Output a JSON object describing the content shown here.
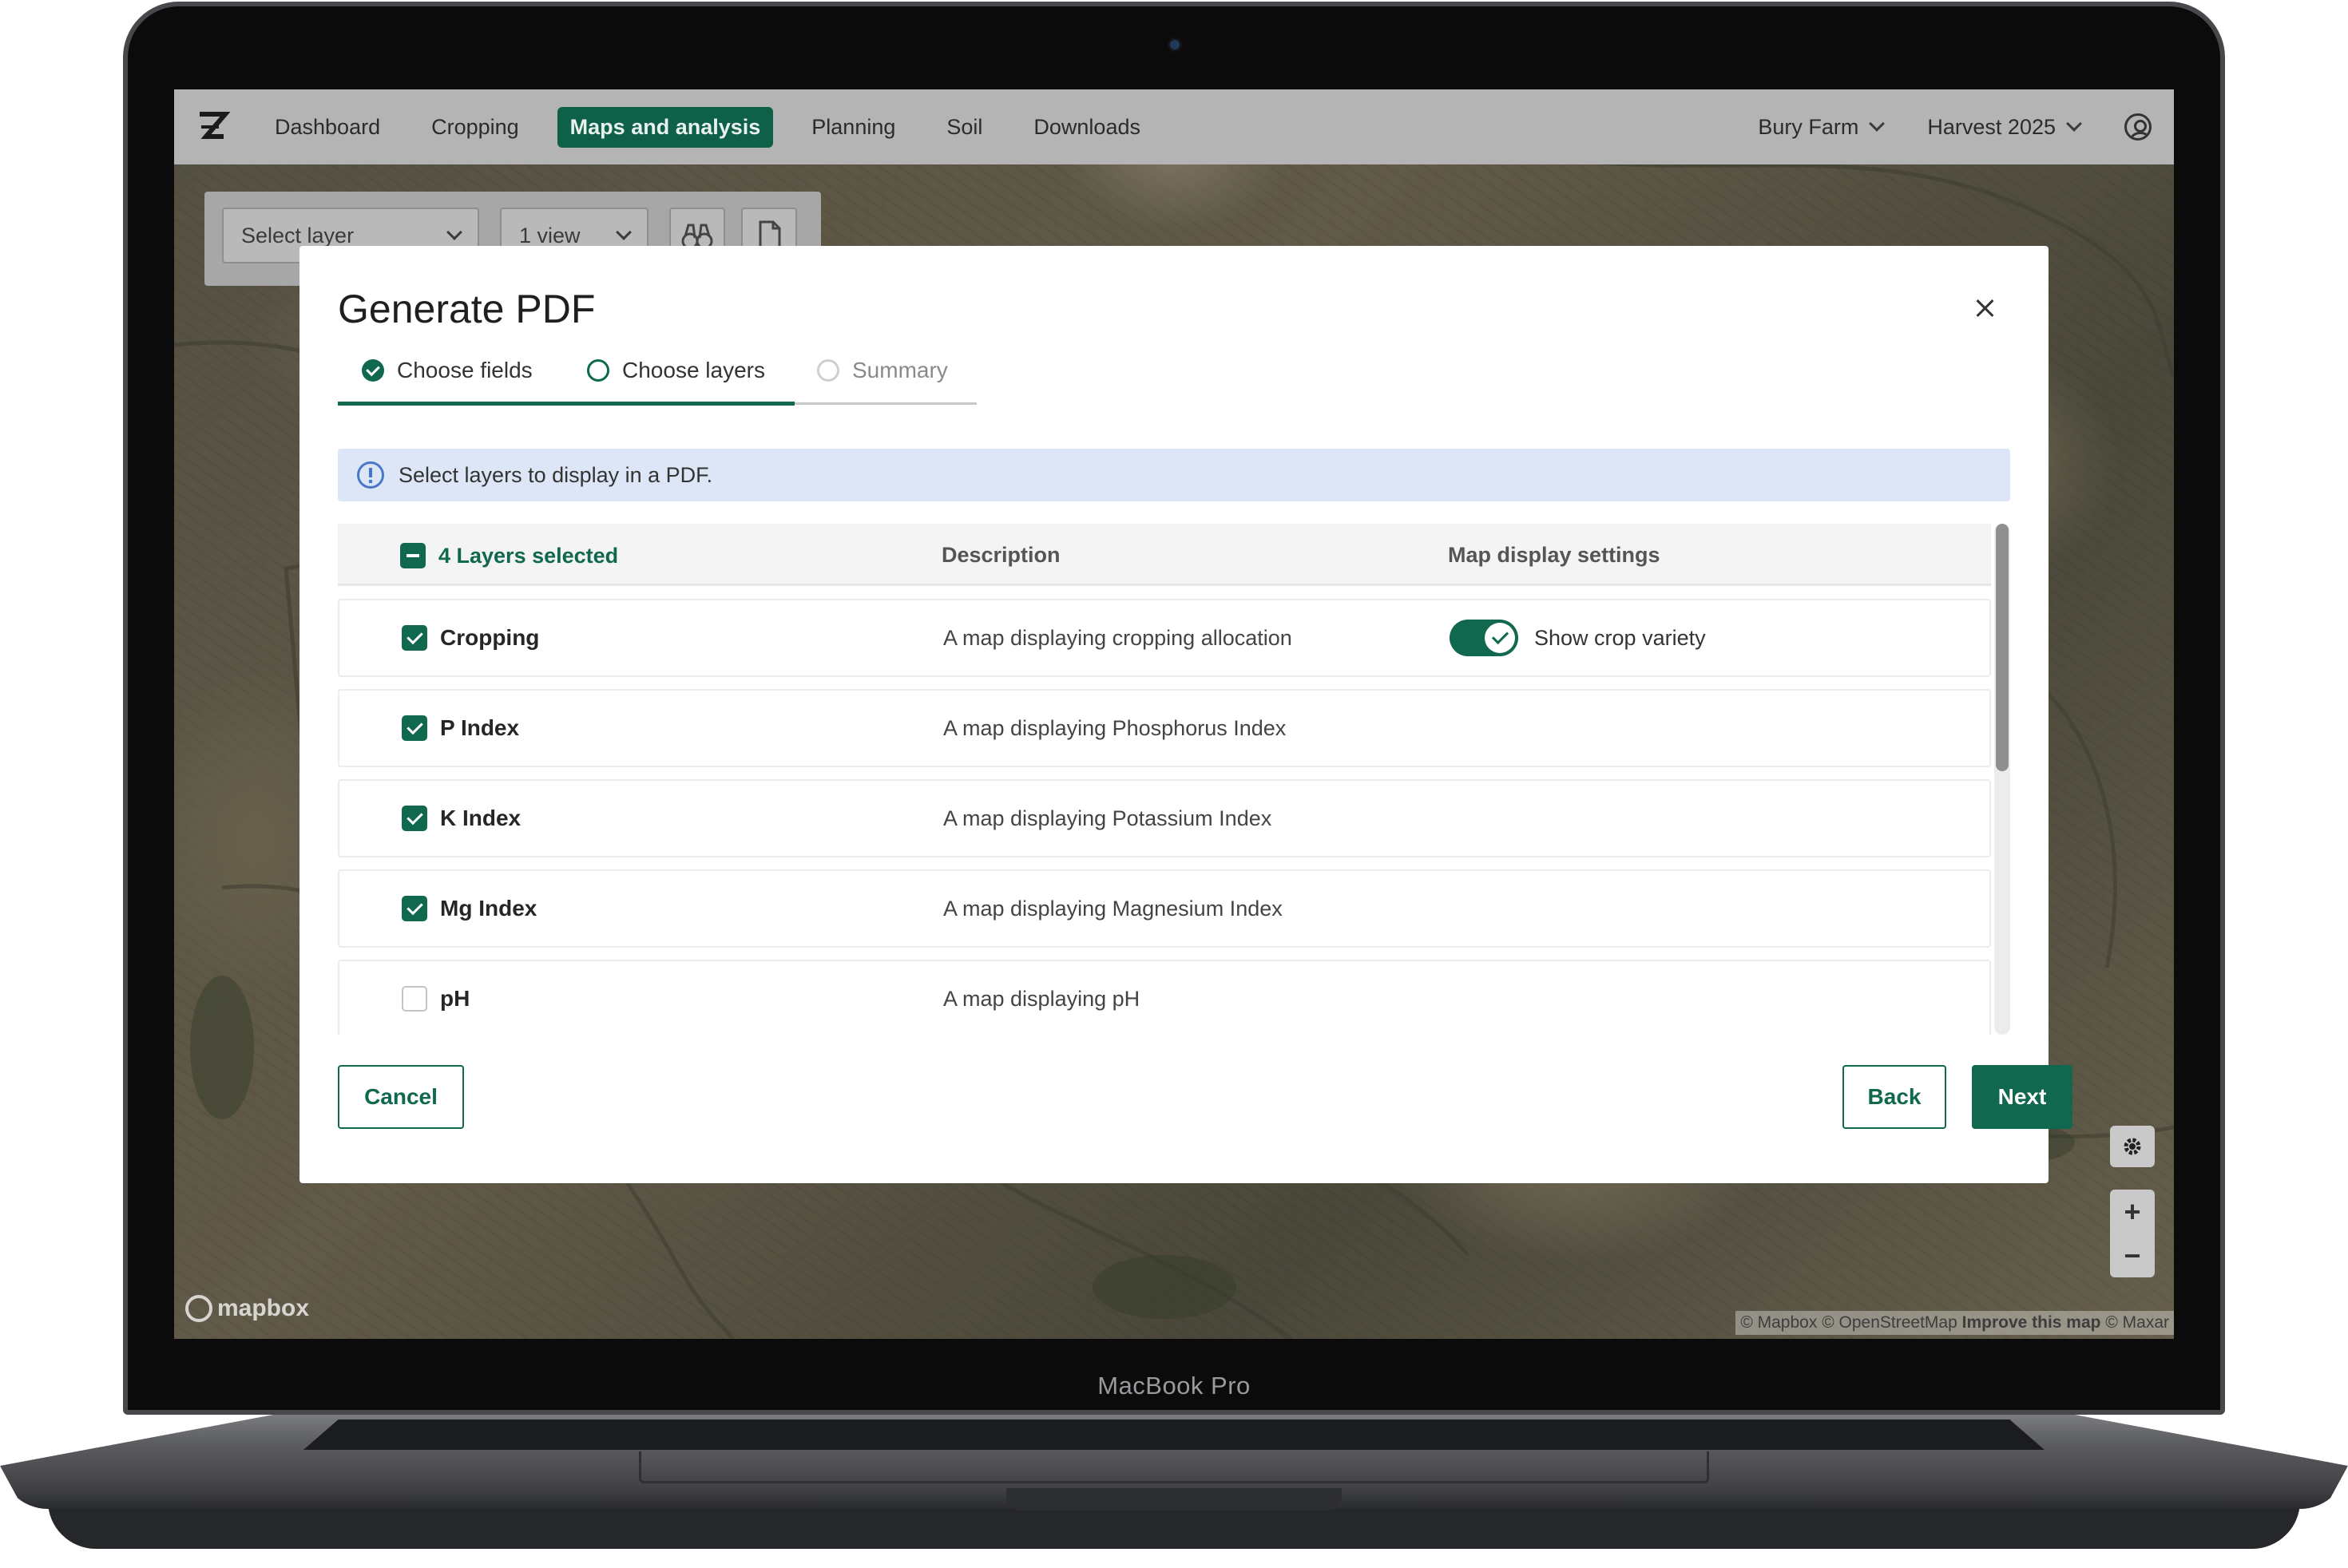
{
  "device": {
    "label": "MacBook Pro"
  },
  "nav": {
    "items": [
      {
        "label": "Dashboard",
        "active": false
      },
      {
        "label": "Cropping",
        "active": false
      },
      {
        "label": "Maps and analysis",
        "active": true
      },
      {
        "label": "Planning",
        "active": false
      },
      {
        "label": "Soil",
        "active": false
      },
      {
        "label": "Downloads",
        "active": false
      }
    ],
    "farm": "Bury Farm",
    "harvest": "Harvest 2025",
    "accent": "#0e6048"
  },
  "map_toolbar": {
    "layer_select": "Select layer",
    "view_select": "1 view"
  },
  "map": {
    "logo": "mapbox",
    "attribution": {
      "mapbox": "© Mapbox",
      "osm": "© OpenStreetMap",
      "improve": "Improve this map",
      "maxar": "© Maxar"
    },
    "controls": [
      "gear-icon",
      "zoom-in",
      "zoom-out"
    ]
  },
  "modal": {
    "title": "Generate PDF",
    "steps": [
      {
        "label": "Choose fields",
        "state": "done"
      },
      {
        "label": "Choose layers",
        "state": "current"
      },
      {
        "label": "Summary",
        "state": "todo"
      }
    ],
    "info": "Select layers to display in a PDF.",
    "table": {
      "selected_label": "4 Layers selected",
      "headers": {
        "description": "Description",
        "settings": "Map display settings"
      },
      "rows": [
        {
          "name": "Cropping",
          "description": "A map displaying cropping allocation",
          "checked": true,
          "setting": "Show crop variety",
          "setting_on": true
        },
        {
          "name": "P Index",
          "description": "A map displaying Phosphorus Index",
          "checked": true
        },
        {
          "name": "K Index",
          "description": "A map displaying Potassium Index",
          "checked": true
        },
        {
          "name": "Mg Index",
          "description": "A map displaying Magnesium Index",
          "checked": true
        },
        {
          "name": "pH",
          "description": "A map displaying pH",
          "checked": false
        }
      ]
    },
    "buttons": {
      "cancel": "Cancel",
      "back": "Back",
      "next": "Next"
    },
    "accent": "#10684e"
  }
}
